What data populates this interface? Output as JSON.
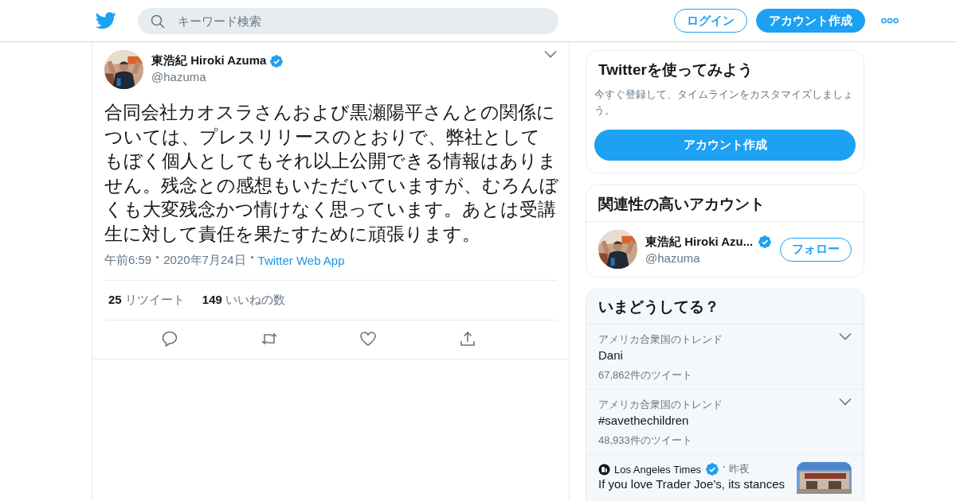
{
  "header": {
    "search": {
      "placeholder": "キーワード検索"
    },
    "buttons": [
      {
        "label": "ログイン",
        "kind": "outline"
      },
      {
        "label": "アカウント作成",
        "kind": "filled"
      }
    ]
  },
  "tweet": {
    "author": {
      "name": "東浩紀 Hiroki Azuma",
      "handle": "@hazuma",
      "verified": true
    },
    "text": "合同会社カオスラさんおよび黒瀬陽平さんとの関係については、プレスリリースのとおりで、弊社としてもぼく個人としてもそれ以上公開できる情報はありません。残念との感想もいただいていますが、むろんぼくも大変残念かつ情けなく思っています。あとは受講生に対して責任を果たすために頑張ります。",
    "time": "午前6:59",
    "date": "2020年7月24日",
    "source": "Twitter Web App",
    "stats": [
      {
        "count": "25",
        "label": "リツイート"
      },
      {
        "count": "149",
        "label": "いいねの数"
      }
    ]
  },
  "signup_card": {
    "title": "Twitterを使ってみよう",
    "subtitle": "今すぐ登録して、タイムラインをカスタマイズしましょう。",
    "button": "アカウント作成"
  },
  "related_accounts": {
    "title": "関連性の高いアカウント",
    "accounts": [
      {
        "name": "東浩紀 Hiroki Azu...",
        "handle": "@hazuma",
        "verified": true,
        "button": "フォロー"
      }
    ]
  },
  "trends": {
    "title": "いまどうしてる？",
    "items": [
      {
        "kind": "trend",
        "context": "アメリカ合衆国のトレンド",
        "topic": "Dani",
        "count": "67,862件のツイート"
      },
      {
        "kind": "trend",
        "context": "アメリカ合衆国のトレンド",
        "topic": "#savethechildren",
        "count": "48,933件のツイート"
      },
      {
        "kind": "news",
        "source": "Los Angeles Times",
        "verified": true,
        "time": "昨夜",
        "headline": "If you love Trader Joe’s, its stances"
      }
    ]
  }
}
